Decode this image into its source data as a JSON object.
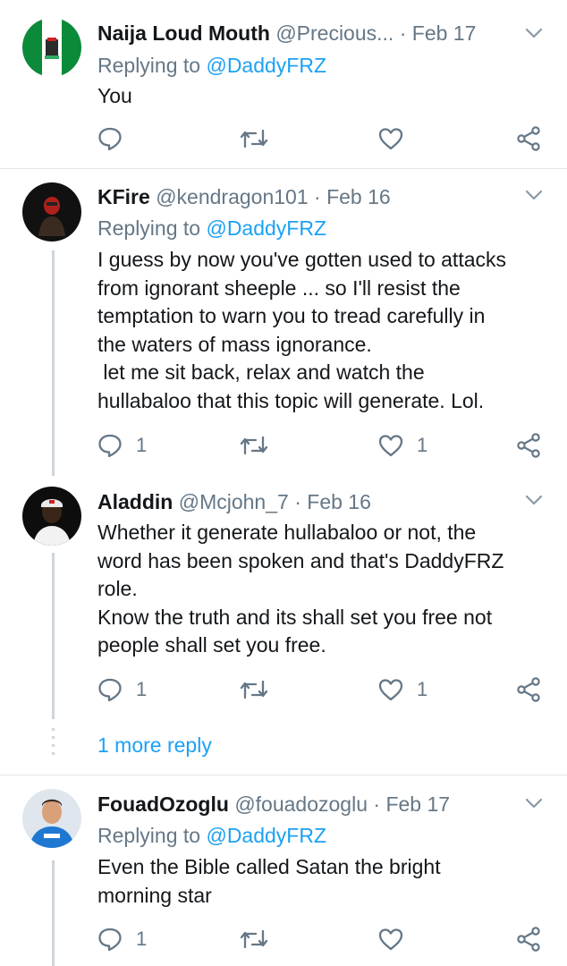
{
  "tweets": [
    {
      "name": "Naija Loud Mouth",
      "handle": "@Precious...",
      "sep": "·",
      "date": "Feb 17",
      "replying_prefix": "Replying to",
      "replying_to": "@DaddyFRZ",
      "text": [
        "You"
      ],
      "reply_count": "",
      "retweet_count": "",
      "like_count": ""
    },
    {
      "name": "KFire",
      "handle": "@kendragon101",
      "sep": "·",
      "date": "Feb 16",
      "replying_prefix": "Replying to",
      "replying_to": "@DaddyFRZ",
      "text": [
        "I guess by now you've gotten used to attacks",
        "from ignorant sheeple ...  so I'll resist the",
        "temptation to warn you to tread carefully in",
        "the waters of mass ignorance.",
        " let me sit back, relax and watch the",
        "hullabaloo that this topic will generate. Lol."
      ],
      "reply_count": "1",
      "retweet_count": "",
      "like_count": "1"
    },
    {
      "name": "Aladdin",
      "handle": "@Mcjohn_7",
      "sep": "·",
      "date": "Feb 16",
      "text": [
        "Whether it generate hullabaloo or not, the",
        "word has been spoken and that's DaddyFRZ",
        "role.",
        "Know the truth and its shall set you free not",
        "people shall set you free."
      ],
      "reply_count": "1",
      "retweet_count": "",
      "like_count": "1"
    },
    {
      "name": "FouadOzoglu",
      "handle": "@fouadozoglu",
      "sep": "·",
      "date": "Feb 17",
      "replying_prefix": "Replying to",
      "replying_to": "@DaddyFRZ",
      "text": [
        "Even the Bible called Satan the bright",
        "morning star"
      ],
      "reply_count": "1",
      "retweet_count": "",
      "like_count": ""
    }
  ],
  "more_replies": "1 more reply",
  "icons": {
    "reply": "reply-icon",
    "retweet": "retweet-icon",
    "like": "heart-icon",
    "share": "share-icon",
    "menu": "chevron-down-icon"
  },
  "colors": {
    "text": "#14171a",
    "muted": "#657786",
    "link": "#1da1f2",
    "divider": "#e1e8ed",
    "thread": "#ccd6dd"
  }
}
